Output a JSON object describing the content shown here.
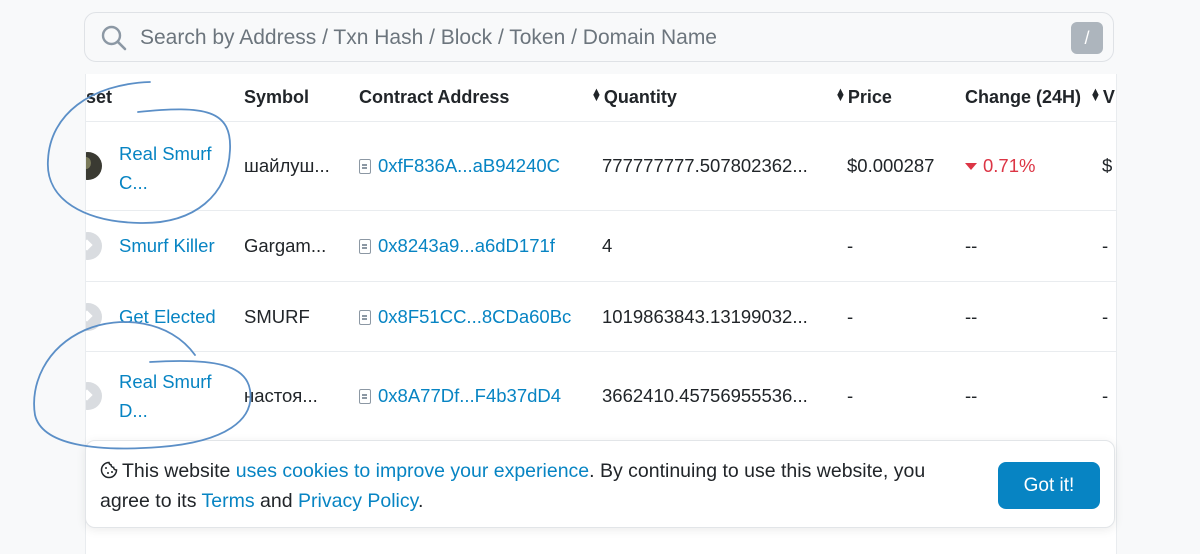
{
  "search": {
    "placeholder": "Search by Address / Txn Hash / Block / Token / Domain Name",
    "shortcut": "/"
  },
  "table": {
    "headers": {
      "asset": "set",
      "symbol": "Symbol",
      "contract": "Contract Address",
      "quantity": "Quantity",
      "price": "Price",
      "change": "Change (24H)",
      "value": "V"
    },
    "rows": [
      {
        "asset_line1": "Real Smurf",
        "asset_line2": "C...",
        "symbol": "шайлуш...",
        "contract": "0xfF836A...aB94240C",
        "quantity": "777777777.507802362...",
        "price": "$0.000287",
        "change": "0.71%",
        "value": "$"
      },
      {
        "asset": "Smurf Killer",
        "symbol": "Gargam...",
        "contract": "0x8243a9...a6dD171f",
        "quantity": "4",
        "price": "-",
        "change": "--",
        "value": "-"
      },
      {
        "asset": "Get Elected",
        "symbol": "SMURF",
        "contract": "0x8F51CC...8CDa60Bc",
        "quantity": "1019863843.13199032...",
        "price": "-",
        "change": "--",
        "value": "-"
      },
      {
        "asset_line1": "Real Smurf",
        "asset_line2": "D...",
        "symbol": "настоя...",
        "contract": "0x8A77Df...F4b37dD4",
        "quantity": "3662410.45756955536...",
        "price": "-",
        "change": "--",
        "value": "-"
      }
    ]
  },
  "cookie": {
    "text1": "This website ",
    "link1": "uses cookies to improve your experience",
    "text2": ". By continuing to use this website, you agree to its ",
    "link2": "Terms",
    "text3": " and ",
    "link3": "Privacy Policy",
    "text4": ".",
    "button": "Got it!"
  },
  "colors": {
    "link": "#0784c3",
    "negative": "#dc3545",
    "button": "#0784c3",
    "scribble": "#5b8fc7"
  }
}
